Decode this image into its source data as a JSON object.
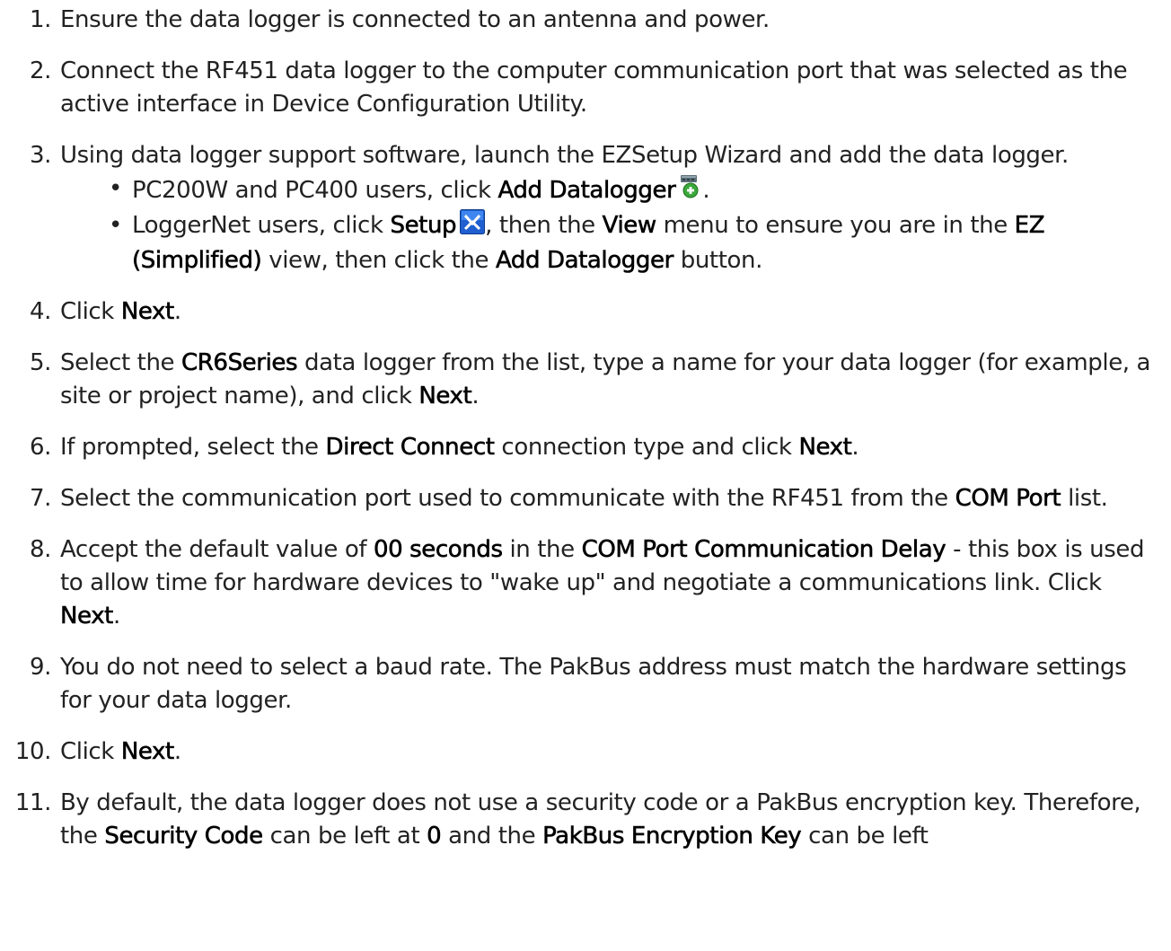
{
  "steps": [
    {
      "num": "1.",
      "text": "Ensure the data logger is connected to an antenna and power."
    },
    {
      "num": "2.",
      "text": "Connect the RF451 data logger to the computer communication port that was selected as the active interface in Device Configuration Utility."
    },
    {
      "num": "3.",
      "text": "Using data logger support software, launch the EZSetup Wizard and add the data logger.",
      "sub": [
        {
          "t1": "PC200W and PC400 users, click ",
          "b1": "Add Datalogger",
          "icon_name": "add-datalogger-icon",
          "t2": "."
        },
        {
          "t1": "LoggerNet users, click ",
          "b1": "Setup",
          "icon_name": "setup-icon",
          "t2": ", then the ",
          "b2": "View",
          "t3": " menu to ensure you are in the ",
          "b3": "EZ (Simplified)",
          "t4": " view, then click the ",
          "b4": "Add Datalogger",
          "t5": " button."
        }
      ]
    },
    {
      "num": "4.",
      "t1": "Click ",
      "b1": "Next",
      "t2": "."
    },
    {
      "num": "5.",
      "t1": "Select the ",
      "b1": "CR6Series",
      "t2": " data logger from the list, type a name for your data logger (for example, a site or project name), and click ",
      "b2": "Next",
      "t3": "."
    },
    {
      "num": "6.",
      "t1": "If prompted, select the ",
      "b1": "Direct Connect",
      "t2": " connection type and click ",
      "b2": "Next",
      "t3": "."
    },
    {
      "num": "7.",
      "t1": "Select the communication port used to communicate with the RF451 from the ",
      "b1": "COM Port",
      "t2": " list."
    },
    {
      "num": "8.",
      "t1": "Accept the default value of ",
      "b1": "00 seconds",
      "t2": " in the ",
      "b2": "COM Port Communication Delay",
      "t3": " - this box is used to allow time for hardware devices to \"wake up\" and negotiate a communications link. Click ",
      "b3": "Next",
      "t4": "."
    },
    {
      "num": "9.",
      "text": "You do not need to select a baud rate. The PakBus address must match the hardware settings for your data logger."
    },
    {
      "num": "10.",
      "t1": "Click ",
      "b1": "Next",
      "t2": "."
    },
    {
      "num": "11.",
      "t1": "By default, the data logger does not use a security code or a PakBus encryption key. Therefore, the ",
      "b1": "Security Code",
      "t2": " can be left at ",
      "b2": "0",
      "t3": " and the ",
      "b3": "PakBus Encryption Key",
      "t4": " can be left"
    }
  ]
}
